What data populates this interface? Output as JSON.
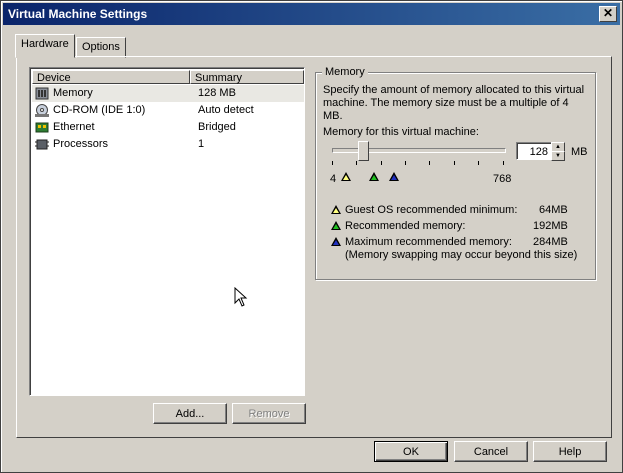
{
  "window": {
    "title": "Virtual Machine Settings",
    "close_glyph": "✕"
  },
  "tabs": [
    {
      "label": "Hardware"
    },
    {
      "label": "Options"
    }
  ],
  "device_list": {
    "columns": [
      "Device",
      "Summary"
    ],
    "rows": [
      {
        "device": "Memory",
        "summary": "128 MB",
        "icon": "memory-icon"
      },
      {
        "device": "CD-ROM (IDE 1:0)",
        "summary": "Auto detect",
        "icon": "cdrom-icon"
      },
      {
        "device": "Ethernet",
        "summary": "Bridged",
        "icon": "ethernet-icon"
      },
      {
        "device": "Processors",
        "summary": "1",
        "icon": "processor-icon"
      }
    ],
    "selected_index": 0
  },
  "buttons": {
    "add": "Add...",
    "remove": "Remove",
    "ok": "OK",
    "cancel": "Cancel",
    "help": "Help"
  },
  "memory": {
    "group_title": "Memory",
    "description": "Specify the amount of memory allocated to this virtual machine. The memory size must be a multiple of 4 MB.",
    "field_label": "Memory for this virtual machine:",
    "value": "128",
    "unit": "MB",
    "slider_min": "4",
    "slider_max": "768",
    "legend": [
      {
        "label": "Guest OS recommended minimum:",
        "value": "64MB",
        "color": "#ffff80"
      },
      {
        "label": "Recommended memory:",
        "value": "192MB",
        "color": "#20c020"
      },
      {
        "label": "Maximum recommended memory:",
        "value": "284MB",
        "color": "#2030c0"
      }
    ],
    "swap_note": "(Memory swapping may occur beyond this size)"
  }
}
